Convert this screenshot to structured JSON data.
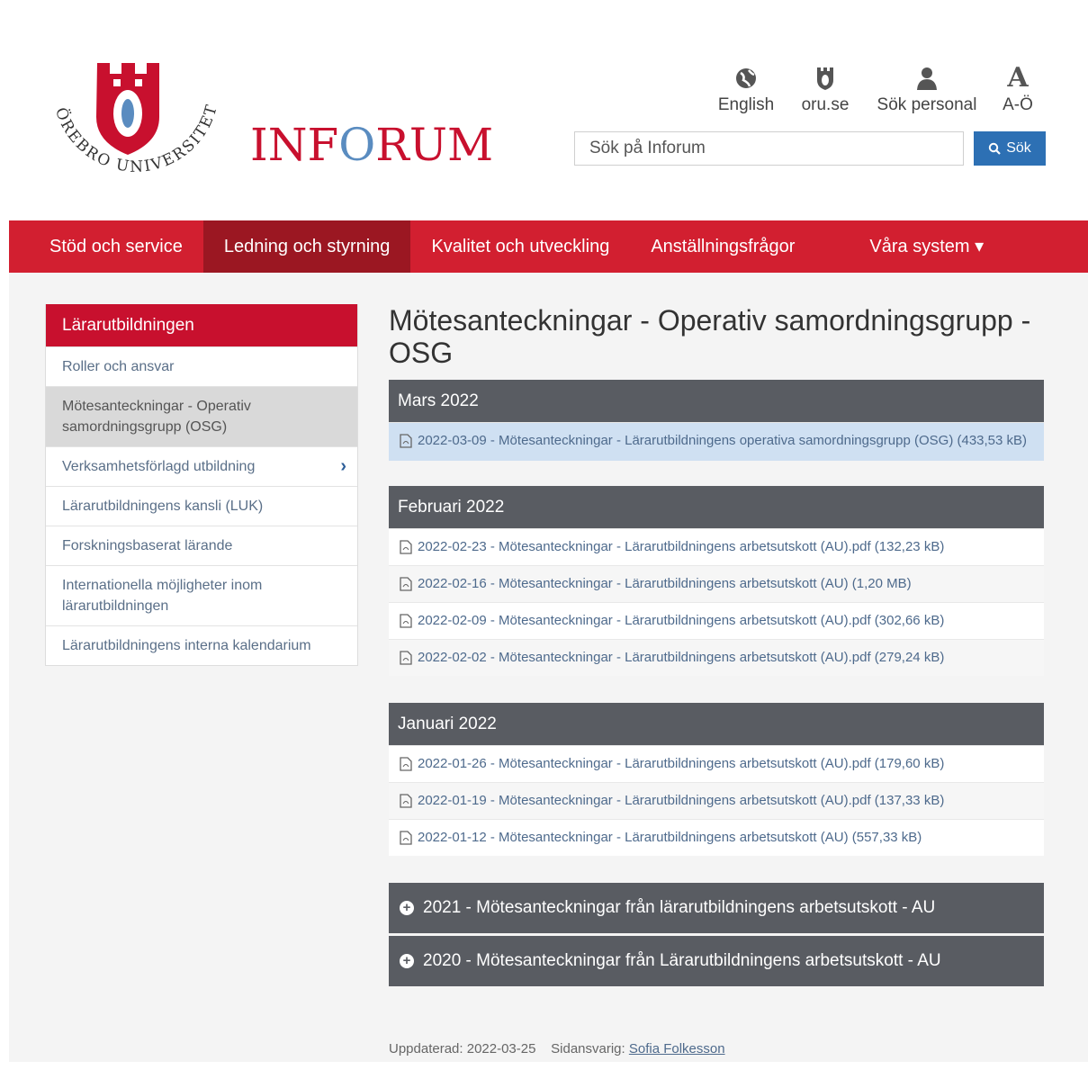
{
  "brand": {
    "logo_arc_text": "ÖREBRO UNIVERSITET",
    "site_name_part1": "INF",
    "site_name_o": "O",
    "site_name_part2": "RUM"
  },
  "utility": [
    {
      "label": "English",
      "icon": "globe-icon"
    },
    {
      "label": "oru.se",
      "icon": "oru-crest-icon"
    },
    {
      "label": "Sök personal",
      "icon": "person-icon"
    },
    {
      "label": "A-Ö",
      "icon": "a-letter-icon",
      "glyph": "A"
    }
  ],
  "search": {
    "placeholder": "Sök på Inforum",
    "button_label": "Sök"
  },
  "nav": [
    {
      "label": "Stöd och service"
    },
    {
      "label": "Ledning och styrning",
      "active": true
    },
    {
      "label": "Kvalitet och utveckling"
    },
    {
      "label": "Anställningsfrågor"
    },
    {
      "label": "Våra system ▾"
    }
  ],
  "sidebar": {
    "heading": "Lärarutbildningen",
    "items": [
      {
        "label": "Roller och ansvar"
      },
      {
        "label": "Mötesanteckningar - Operativ samordningsgrupp (OSG)",
        "active": true
      },
      {
        "label": "Verksamhetsförlagd utbildning",
        "chevron": "›"
      },
      {
        "label": "Lärarutbildningens kansli (LUK)"
      },
      {
        "label": "Forskningsbaserat lärande"
      },
      {
        "label": "Internationella möjligheter inom lärarutbildningen"
      },
      {
        "label": "Lärarutbildningens interna kalendarium"
      }
    ]
  },
  "main": {
    "title": "Mötesanteckningar - Operativ samordningsgrupp -OSG",
    "sections": [
      {
        "heading": "Mars 2022",
        "files": [
          {
            "label": "2022-03-09 - Mötesanteckningar - Lärarutbildningens operativa samordningsgrupp (OSG) (433,53 kB)",
            "highlight": true
          }
        ]
      },
      {
        "heading": "Februari 2022",
        "files": [
          {
            "label": "2022-02-23 - Mötesanteckningar - Lärarutbildningens arbetsutskott (AU).pdf (132,23 kB)"
          },
          {
            "label": "2022-02-16 - Mötesanteckningar - Lärarutbildningens arbetsutskott (AU) (1,20 MB)"
          },
          {
            "label": "2022-02-09 - Mötesanteckningar - Lärarutbildningens arbetsutskott (AU).pdf (302,66 kB)"
          },
          {
            "label": "2022-02-02 - Mötesanteckningar - Lärarutbildningens arbetsutskott (AU).pdf (279,24 kB)"
          }
        ]
      },
      {
        "heading": "Januari 2022",
        "files": [
          {
            "label": "2022-01-26 - Mötesanteckningar - Lärarutbildningens arbetsutskott (AU).pdf (179,60 kB)"
          },
          {
            "label": "2022-01-19 - Mötesanteckningar - Lärarutbildningens arbetsutskott (AU).pdf (137,33 kB)"
          },
          {
            "label": "2022-01-12 - Mötesanteckningar - Lärarutbildningens arbetsutskott (AU) (557,33 kB)"
          }
        ]
      }
    ],
    "accordions": [
      {
        "label": "2021 - Mötesanteckningar från lärarutbildningens arbetsutskott - AU"
      },
      {
        "label": "2020 - Mötesanteckningar från Lärarutbildningens arbetsutskott - AU"
      }
    ]
  },
  "footer": {
    "updated": "Uppdaterad: 2022-03-25",
    "responsible_label": "Sidansvarig:",
    "responsible_name": "Sofia Folkesson"
  },
  "colors": {
    "brand_red": "#d21f30",
    "nav_active": "#9b1722",
    "panel_header": "#595c62",
    "search_button": "#2d70b4",
    "link": "#4e6a8c",
    "highlight_row": "#cfe0f2"
  }
}
